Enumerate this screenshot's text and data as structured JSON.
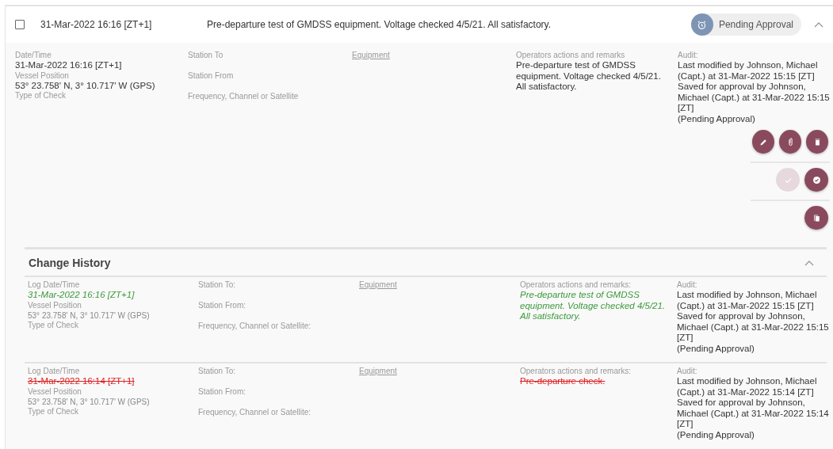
{
  "entry": {
    "checked": false,
    "datetime": "31-Mar-2022 16:16 [ZT+1]",
    "summary": "Pre-departure test of GMDSS equipment. Voltage checked 4/5/21. All satisfactory.",
    "status": "Pending Approval",
    "expanded": true
  },
  "details": {
    "datetime_label": "Date/Time",
    "datetime": "31-Mar-2022 16:16 [ZT+1]",
    "position_label": "Vessel Position",
    "position": "53° 23.758' N, 3° 10.717' W (GPS)",
    "check_label": "Type of Check",
    "station_to": "Station To",
    "station_from": "Station From",
    "frequency": "Frequency, Channel or Satellite",
    "equipment": "Equipment",
    "remarks_label": "Operators actions and remarks",
    "remarks": "Pre-departure test of GMDSS equipment. Voltage checked 4/5/21. All satisfactory.",
    "audit_label": "Audit:",
    "audit": [
      "Last modified by Johnson, Michael (Capt.) at 31-Mar-2022 15:15 [ZT]",
      "Saved for approval by Johnson, Michael (Capt.) at 31-Mar-2022 15:15 [ZT]",
      "(Pending Approval)"
    ]
  },
  "actions": [
    [
      {
        "kind": "edit",
        "disabled": false
      },
      {
        "kind": "attach",
        "disabled": false
      },
      {
        "kind": "delete",
        "disabled": false
      }
    ],
    [
      {
        "kind": "approve",
        "disabled": true
      },
      {
        "kind": "verify",
        "disabled": false
      }
    ],
    [
      {
        "kind": "copy",
        "disabled": false
      }
    ]
  ],
  "history": {
    "title": "Change History",
    "expanded": true,
    "rows": [
      {
        "removed": false,
        "datetime_label": "Log Date/Time",
        "datetime": "31-Mar-2022 16:16 [ZT+1]",
        "position_label": "Vessel Position",
        "position": "53° 23.758' N, 3° 10.717' W (GPS)",
        "check_label": "Type of Check",
        "station_to": "Station To:",
        "station_from": "Station From:",
        "frequency": "Frequency, Channel or Satellite:",
        "equipment": "Equipment",
        "remarks_label": "Operators actions and remarks:",
        "remarks": "Pre-departure test of GMDSS equipment. Voltage checked 4/5/21. All satisfactory.",
        "audit_label": "Audit:",
        "audit": [
          "Last modified by Johnson, Michael (Capt.) at 31-Mar-2022 15:15 [ZT]",
          "Saved for approval by Johnson, Michael (Capt.) at 31-Mar-2022 15:15 [ZT]",
          "(Pending Approval)"
        ]
      },
      {
        "removed": true,
        "datetime_label": "Log Date/Time",
        "datetime": "31-Mar-2022 16:14 [ZT+1]",
        "position_label": "Vessel Position",
        "position": "53° 23.758' N, 3° 10.717' W (GPS)",
        "check_label": "Type of Check",
        "station_to": "Station To:",
        "station_from": "Station From:",
        "frequency": "Frequency, Channel or Satellite:",
        "equipment": "Equipment",
        "remarks_label": "Operators actions and remarks:",
        "remarks": "Pre-departure check.",
        "audit_label": "Audit:",
        "audit": [
          "Last modified by Johnson, Michael (Capt.) at 31-Mar-2022 15:14 [ZT]",
          "Saved for approval by Johnson, Michael (Capt.) at 31-Mar-2022 15:14 [ZT]",
          "(Pending Approval)"
        ]
      }
    ]
  }
}
